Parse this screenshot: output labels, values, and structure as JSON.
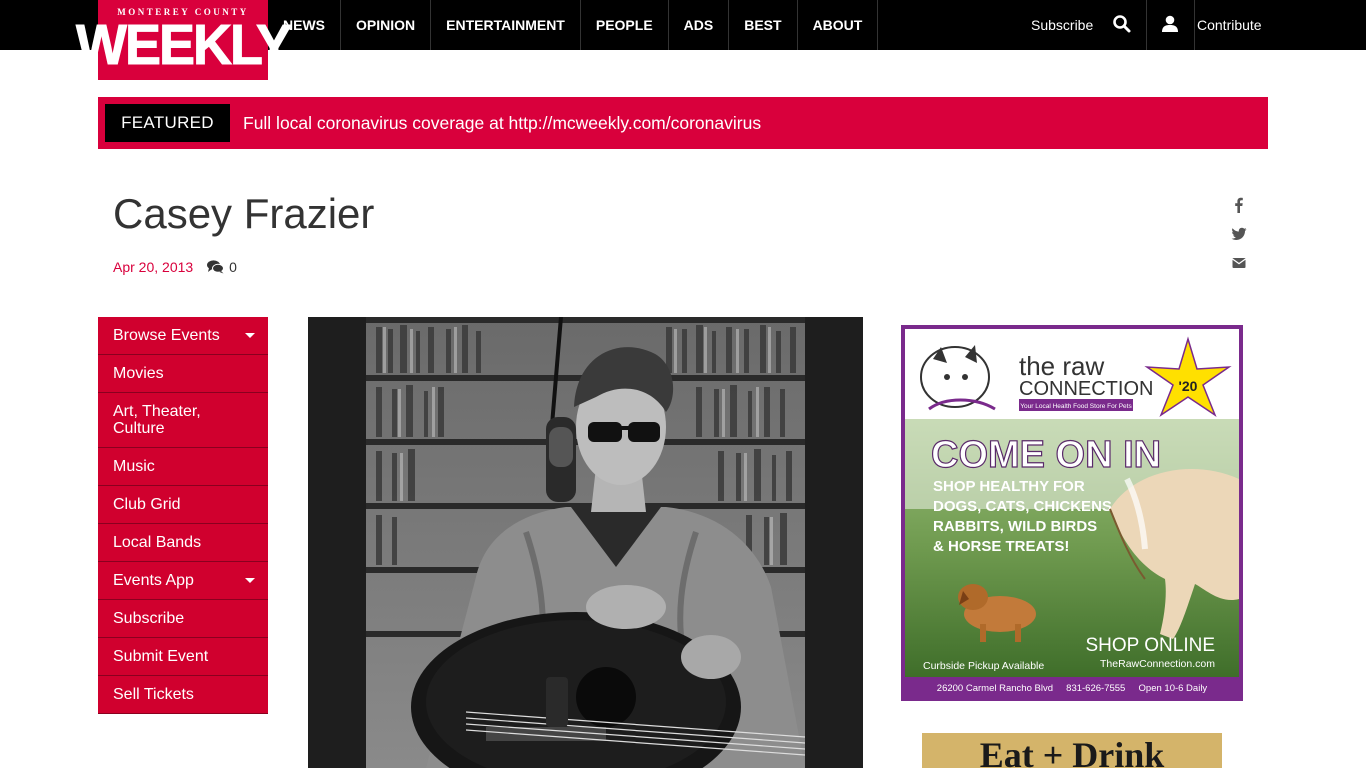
{
  "logo": {
    "small": "MONTEREY COUNTY",
    "big": "WEEKLY"
  },
  "nav": {
    "items": [
      "NEWS",
      "OPINION",
      "ENTERTAINMENT",
      "PEOPLE",
      "ADS",
      "BEST",
      "ABOUT"
    ]
  },
  "header_right": {
    "subscribe": "Subscribe",
    "contribute": "Contribute"
  },
  "featured": {
    "label": "FEATURED",
    "text": "Full local coronavirus coverage at http://mcweekly.com/coronavirus"
  },
  "article": {
    "title": "Casey Frazier",
    "date": "Apr 20, 2013",
    "comment_count": "0"
  },
  "side_menu": {
    "items": [
      {
        "label": "Browse Events",
        "has_caret": true
      },
      {
        "label": "Movies"
      },
      {
        "label": "Art, Theater, Culture"
      },
      {
        "label": "Music"
      },
      {
        "label": "Club Grid"
      },
      {
        "label": "Local Bands"
      },
      {
        "label": "Events App",
        "has_caret": true
      },
      {
        "label": "Subscribe"
      },
      {
        "label": "Submit Event"
      },
      {
        "label": "Sell Tickets"
      }
    ]
  },
  "ad1": {
    "brand_line1": "the raw",
    "brand_line2": "CONNECTION",
    "tagline": "Your Local Health Food Store For Pets",
    "year": "'20",
    "headline": "COME ON IN",
    "body1": "SHOP HEALTHY FOR",
    "body2": "DOGS, CATS, CHICKENS",
    "body3": "RABBITS, WILD BIRDS",
    "body4": "& HORSE TREATS!",
    "shop_online": "SHOP ONLINE",
    "curbside": "Curbside Pickup Available",
    "website": "TheRawConnection.com",
    "footer": "26200 Carmel Rancho Blvd     831-626-7555     Open 10-6 Daily"
  },
  "ad2": {
    "text": "Eat + Drink"
  },
  "colors": {
    "brand_red": "#d9003c",
    "menu_red": "#d0002e",
    "topbar": "#000000",
    "ad_purple": "#7a2a8c"
  }
}
